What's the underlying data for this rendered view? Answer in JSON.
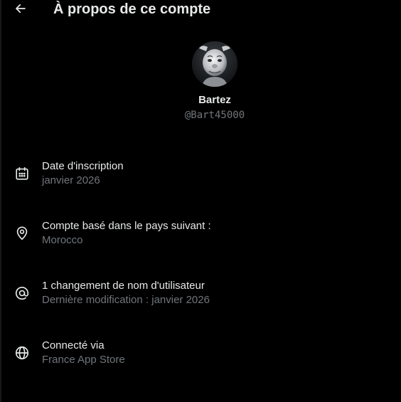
{
  "header": {
    "title": "À propos de ce compte",
    "back_icon": "arrow-left-icon"
  },
  "profile": {
    "display_name": "Bartez",
    "handle": "@Bart45000",
    "avatar_icon": "avatar-image"
  },
  "info_items": [
    {
      "icon": "calendar-icon",
      "title": "Date d'inscription",
      "value": "janvier 2026"
    },
    {
      "icon": "location-pin-icon",
      "title": "Compte basé dans le pays suivant :",
      "value": "Morocco"
    },
    {
      "icon": "at-sign-icon",
      "title": "1 changement de nom d'utilisateur",
      "value": "Dernière modification : janvier 2026"
    },
    {
      "icon": "globe-icon",
      "title": "Connecté via",
      "value": "France App Store"
    }
  ],
  "colors": {
    "background": "#000000",
    "primary_text": "#e7e9ea",
    "secondary_text": "#71767b"
  }
}
